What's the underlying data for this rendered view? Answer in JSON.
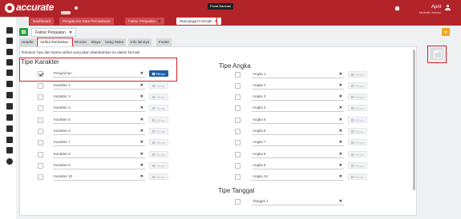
{
  "header": {
    "brand": "accurate",
    "brand_sub": "online",
    "brand_tag": "online",
    "help_label": "Pusat Bantuan",
    "user_name": "April",
    "user_company": "Michelin Antam"
  },
  "module_tabs": [
    {
      "label": "Dashboard",
      "closable": false
    },
    {
      "label": "Pengaturan Data Perusahaan",
      "closable": false
    },
    {
      "label": "Faktur Penjualan",
      "closable": true
    },
    {
      "label": "Rancangan Formulir",
      "closable": true
    }
  ],
  "subtab": {
    "label": "Faktur Penjualan"
  },
  "form_tabs": [
    "Header",
    "Atribut Tambahan",
    "Rincian",
    "Biaya",
    "Uang Muka",
    "Info lainnya",
    "Footer"
  ],
  "info_text": "Tentukan Tipe dan Nama atribut yang akan ditambahkan ke dalam formulir",
  "pilih_label": "Pilihan",
  "tipe_karakter": {
    "title": "Tipe Karakter",
    "rows": [
      {
        "value": "Pengiriman",
        "checked": true
      },
      {
        "value": "Karakter 2",
        "checked": false
      },
      {
        "value": "Karakter 3",
        "checked": false
      },
      {
        "value": "Karakter 4",
        "checked": false
      },
      {
        "value": "Karakter 5",
        "checked": false
      },
      {
        "value": "Karakter 6",
        "checked": false
      },
      {
        "value": "Karakter 7",
        "checked": false
      },
      {
        "value": "Karakter 8",
        "checked": false
      },
      {
        "value": "Karakter 9",
        "checked": false
      },
      {
        "value": "Karakter 10",
        "checked": false
      }
    ]
  },
  "tipe_angka": {
    "title": "Tipe Angka",
    "rows": [
      {
        "value": "Angka 1"
      },
      {
        "value": "Angka 2"
      },
      {
        "value": "Angka 3"
      },
      {
        "value": "Angka 4"
      },
      {
        "value": "Angka 5"
      },
      {
        "value": "Angka 6"
      },
      {
        "value": "Angka 7"
      },
      {
        "value": "Angka 8"
      },
      {
        "value": "Angka 9"
      },
      {
        "value": "Angka 10"
      }
    ]
  },
  "tipe_tanggal": {
    "title": "Tipe Tanggal",
    "rows": [
      {
        "value": "Tanggal 1"
      }
    ]
  },
  "colors": {
    "brand": "#b3242a",
    "highlight": "#d91f26",
    "primary": "#1f5fa9",
    "add": "#2e9f45",
    "accent": "#f2a81d"
  }
}
